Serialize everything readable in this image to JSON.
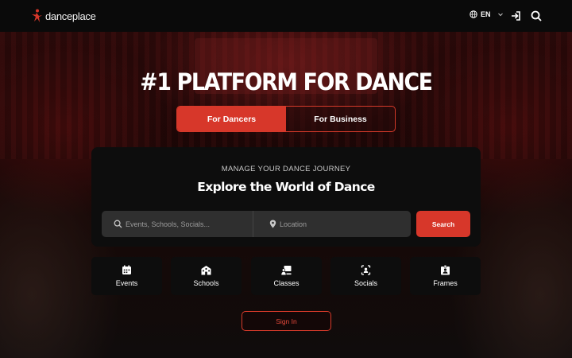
{
  "header": {
    "logo_text": "danceplace",
    "language": "EN"
  },
  "hero": {
    "title": "#1 PLATFORM FOR DANCE",
    "tabs": [
      {
        "label": "For Dancers",
        "active": true
      },
      {
        "label": "For Business",
        "active": false
      }
    ]
  },
  "search_card": {
    "subtitle": "MANAGE YOUR DANCE JOURNEY",
    "title": "Explore the World of Dance",
    "query_placeholder": "Events, Schools, Socials...",
    "location_placeholder": "Location",
    "search_label": "Search"
  },
  "categories": [
    {
      "label": "Events",
      "icon": "calendar-icon"
    },
    {
      "label": "Schools",
      "icon": "school-icon"
    },
    {
      "label": "Classes",
      "icon": "classes-icon"
    },
    {
      "label": "Socials",
      "icon": "socials-icon"
    },
    {
      "label": "Frames",
      "icon": "frames-icon"
    }
  ],
  "signin_label": "Sign In",
  "colors": {
    "accent": "#d7372a",
    "header_bg": "#0a0a0a",
    "card_bg": "#0d0d0d",
    "input_bg": "#2f2f2f"
  }
}
